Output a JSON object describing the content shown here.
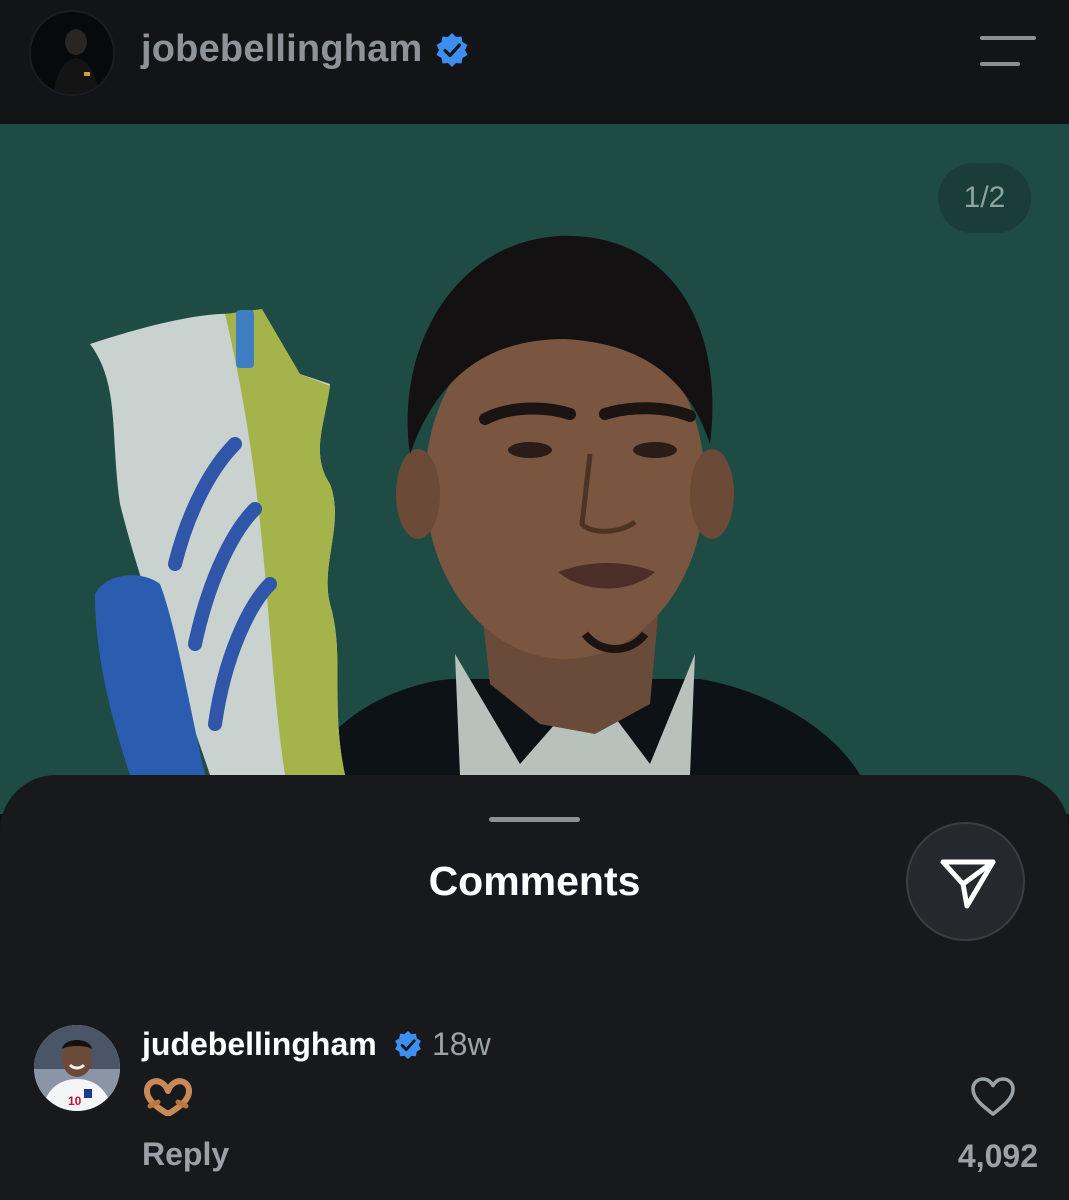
{
  "header": {
    "username": "jobebellingham",
    "verified_icon": "verified-badge-icon",
    "menu_icon": "hamburger-menu-icon"
  },
  "post": {
    "image_counter": "1/2",
    "current_image": 1,
    "total_images": 2
  },
  "comments_sheet": {
    "title": "Comments",
    "share_icon": "send-icon",
    "comments": [
      {
        "username": "judebellingham",
        "verified": true,
        "time": "18w",
        "text": "🫶🏽",
        "reply_label": "Reply",
        "like_icon": "heart-outline-icon",
        "likes": "4,092"
      }
    ]
  },
  "colors": {
    "header_bg": "#121418",
    "photo_bg": "#1e4b44",
    "sheet_bg": "#17191d",
    "verified_blue": "#3d8ef0",
    "muted_text": "#9ca1a8"
  }
}
